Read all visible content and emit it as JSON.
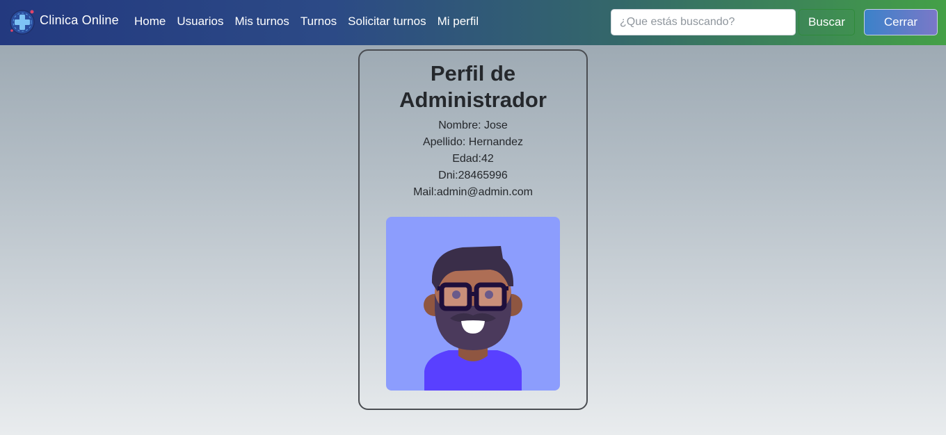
{
  "brand": {
    "name": "Clinica Online",
    "logo_icon": "medical-cross-icon"
  },
  "nav": {
    "links": [
      {
        "label": "Home"
      },
      {
        "label": "Usuarios"
      },
      {
        "label": "Mis turnos"
      },
      {
        "label": "Turnos"
      },
      {
        "label": "Solicitar turnos"
      },
      {
        "label": "Mi perfil"
      }
    ]
  },
  "search": {
    "placeholder": "¿Que estás buscando?",
    "value": "",
    "button_label": "Buscar"
  },
  "logout": {
    "label": "Cerrar"
  },
  "profile": {
    "title": "Perfil de Administrador",
    "lines": [
      "Nombre: Jose",
      "Apellido: Hernandez",
      "Edad:42",
      "Dni:28465996",
      "Mail:admin@admin.com"
    ],
    "avatar_icon": "man-with-glasses-avatar"
  },
  "colors": {
    "navbar_start": "#23397f",
    "navbar_end": "#44a047",
    "avatar_bg": "#8c9dfd",
    "card_border": "#4a4d52",
    "cerrar_start": "#3b82c9",
    "cerrar_end": "#7a78c8"
  }
}
